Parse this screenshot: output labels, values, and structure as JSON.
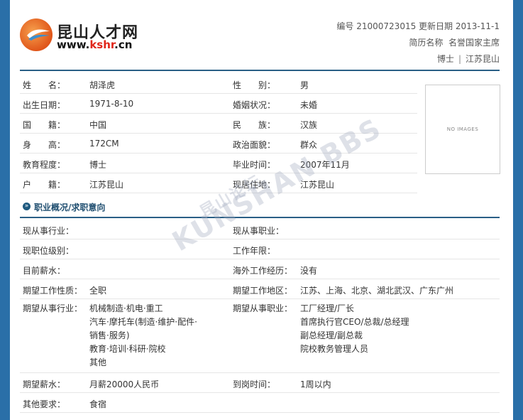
{
  "header": {
    "logo_name": "昆山人才网",
    "logo_url_prefix": "www.",
    "logo_url_brand": "kshr",
    "logo_url_suffix": ".cn",
    "id_label": "编号",
    "id_value": "21000723015",
    "updated_label": "更新日期",
    "updated_value": "2013-11-1",
    "resume_name_label": "简历名称",
    "resume_name_value": "名誉国家主席",
    "degree": "博士",
    "separator": "|",
    "location": "江苏昆山"
  },
  "photo": {
    "placeholder": "NO IMAGES"
  },
  "basic_info": [
    {
      "l1": "姓　　名：",
      "v1": "胡泽虎",
      "l2": "性　　别：",
      "v2": "男"
    },
    {
      "l1": "出生日期：",
      "v1": "1971-8-10",
      "l2": "婚姻状况：",
      "v2": "未婚"
    },
    {
      "l1": "国　　籍：",
      "v1": "中国",
      "l2": "民　　族：",
      "v2": "汉族"
    },
    {
      "l1": "身　　高：",
      "v1": "172CM",
      "l2": "政治面貌：",
      "v2": "群众"
    },
    {
      "l1": "教育程度：",
      "v1": "博士",
      "l2": "毕业时间：",
      "v2": "2007年11月"
    },
    {
      "l1": "户　　籍：",
      "v1": "江苏昆山",
      "l2": "现居住地：",
      "v2": "江苏昆山"
    }
  ],
  "section": {
    "title": "职业概况/求职意向",
    "arrow": "»"
  },
  "career": {
    "r1": {
      "l1": "现从事行业：",
      "v1": "",
      "l2": "现从事职业：",
      "v2": ""
    },
    "r2": {
      "l1": "现职位级别：",
      "v1": "",
      "l2": "工作年限：",
      "v2": ""
    },
    "r3": {
      "l1": "目前薪水：",
      "v1": "",
      "l2": "海外工作经历：",
      "v2": "没有"
    },
    "r4": {
      "l1": "期望工作性质：",
      "v1": "全职",
      "l2": "期望工作地区：",
      "v2": "江苏、上海、北京、湖北武汉、广东广州"
    },
    "r5": {
      "l1": "期望从事行业：",
      "v1_lines": [
        "机械制造·机电·重工",
        "汽车·摩托车(制造·维护·配件·",
        "销售·服务)",
        "教育·培训·科研·院校",
        "其他"
      ],
      "l2": "期望从事职业：",
      "v2_lines": [
        "工厂经理/厂长",
        "首席执行官CEO/总裁/总经理",
        "副总经理/副总裁",
        "院校教务管理人员"
      ]
    },
    "r6": {
      "l1": "期望薪水：",
      "v1": "月薪20000人民币",
      "l2": "到岗时间：",
      "v2": "1周以内"
    },
    "r7": {
      "l1": "其他要求：",
      "v1": "食宿",
      "l2": "",
      "v2": ""
    }
  },
  "watermark": {
    "cn": "昆山论坛",
    "en": "KUNSHAN BBS"
  },
  "colors": {
    "background": "#2a6fa8",
    "rule": "#2a5f86",
    "section_title": "#1f4e70"
  }
}
